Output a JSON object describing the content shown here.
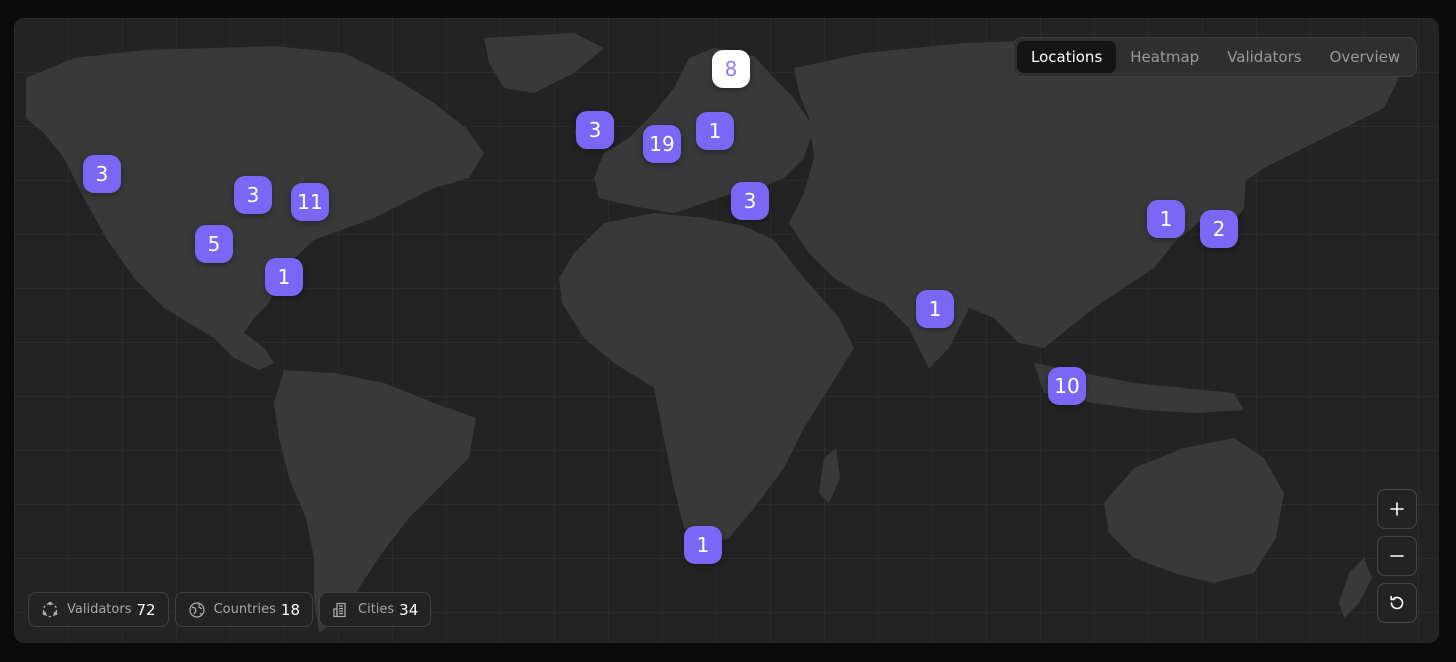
{
  "tabs": [
    "Locations",
    "Heatmap",
    "Validators",
    "Overview"
  ],
  "active_tab": "Locations",
  "markers": [
    "3",
    "3",
    "11",
    "5",
    "1",
    "3",
    "19",
    "1",
    "8",
    "3",
    "1",
    "2",
    "1",
    "10",
    "1"
  ],
  "stats": {
    "validators": {
      "label": "Validators",
      "value": "72",
      "icon": "network-icon"
    },
    "countries": {
      "label": "Countries",
      "value": "18",
      "icon": "globe-icon"
    },
    "cities": {
      "label": "Cities",
      "value": "34",
      "icon": "building-icon"
    }
  },
  "controls": {
    "zoom_in_icon": "plus-icon",
    "zoom_out_icon": "minus-icon",
    "reset_icon": "reset-icon"
  },
  "colors": {
    "marker": "#7a67f5",
    "marker_selected_bg": "#ffffff",
    "marker_selected_text": "#8b7cf8",
    "background": "#232323",
    "land": "#393939"
  }
}
